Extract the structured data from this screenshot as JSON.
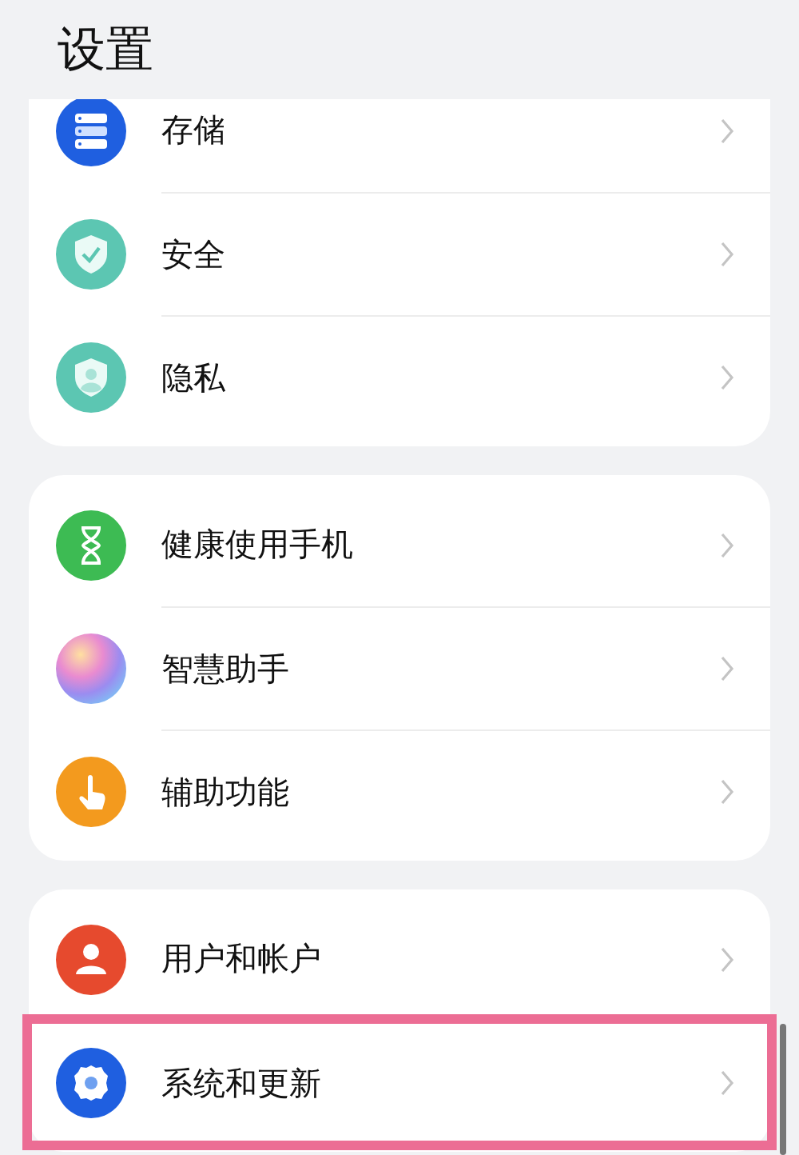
{
  "title": "设置",
  "groups": [
    {
      "items": [
        {
          "label": "存储",
          "highlighted": false
        },
        {
          "label": "安全",
          "highlighted": false
        },
        {
          "label": "隐私",
          "highlighted": false
        }
      ]
    },
    {
      "items": [
        {
          "label": "健康使用手机",
          "highlighted": false
        },
        {
          "label": "智慧助手",
          "highlighted": false
        },
        {
          "label": "辅助功能",
          "highlighted": false
        }
      ]
    },
    {
      "items": [
        {
          "label": "用户和帐户",
          "highlighted": false
        },
        {
          "label": "系统和更新",
          "highlighted": true
        }
      ]
    }
  ]
}
